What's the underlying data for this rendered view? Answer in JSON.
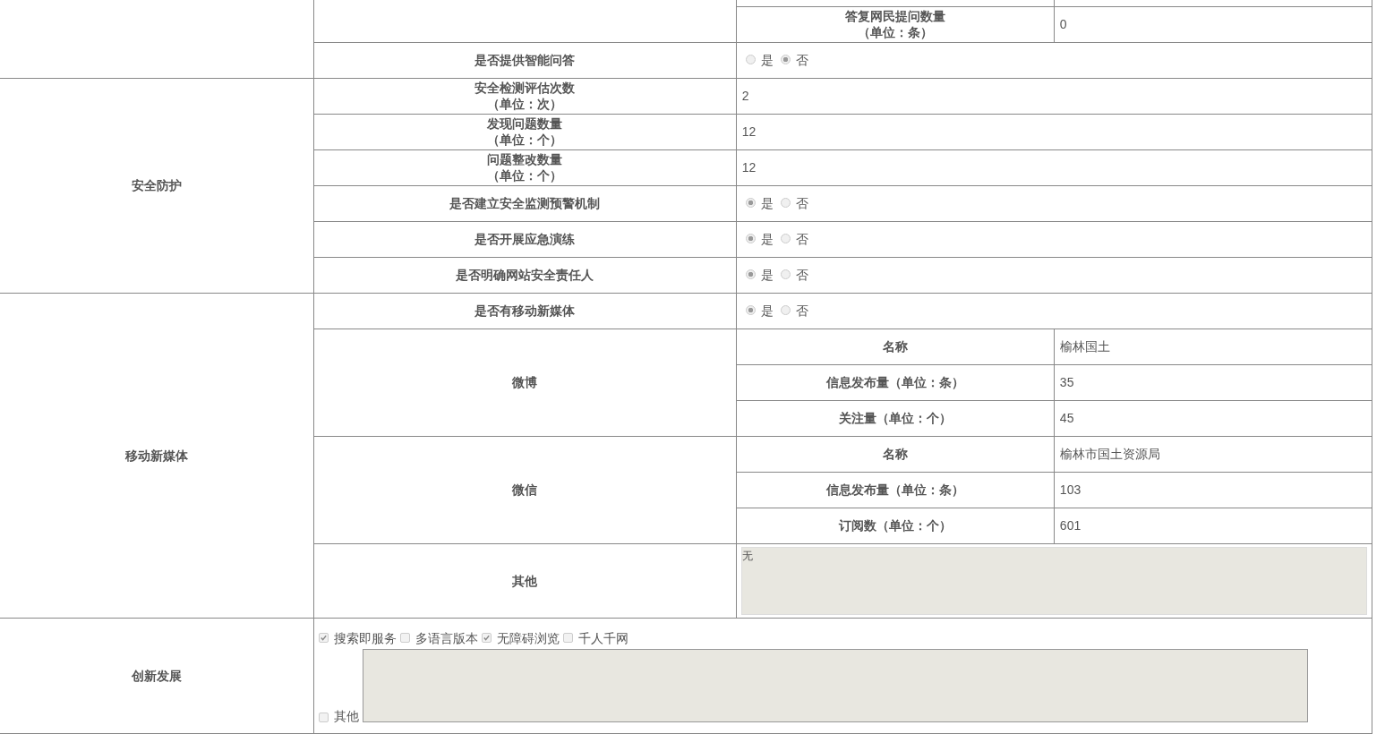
{
  "qa": {
    "reply_count": {
      "label": "答复网民提问数量",
      "unit": "（单位：条）",
      "value": "0"
    },
    "smart_qa": {
      "label": "是否提供智能问答",
      "options": [
        {
          "label": "是",
          "selected": false
        },
        {
          "label": "否",
          "selected": true
        }
      ]
    }
  },
  "security": {
    "title": "安全防护",
    "counts": [
      {
        "label": "安全检测评估次数",
        "unit": "（单位：次）",
        "value": "2"
      },
      {
        "label": "发现问题数量",
        "unit": "（单位：个）",
        "value": "12"
      },
      {
        "label": "问题整改数量",
        "unit": "（单位：个）",
        "value": "12"
      }
    ],
    "questions": [
      {
        "label": "是否建立安全监测预警机制",
        "options": [
          {
            "label": "是",
            "selected": true
          },
          {
            "label": "否",
            "selected": false
          }
        ]
      },
      {
        "label": "是否开展应急演练",
        "options": [
          {
            "label": "是",
            "selected": true
          },
          {
            "label": "否",
            "selected": false
          }
        ]
      },
      {
        "label": "是否明确网站安全责任人",
        "options": [
          {
            "label": "是",
            "selected": true
          },
          {
            "label": "否",
            "selected": false
          }
        ]
      }
    ]
  },
  "media": {
    "title": "移动新媒体",
    "has_media": {
      "label": "是否有移动新媒体",
      "options": [
        {
          "label": "是",
          "selected": true
        },
        {
          "label": "否",
          "selected": false
        }
      ]
    },
    "accounts": [
      {
        "name": "微博",
        "fields": [
          {
            "label": "名称",
            "value": "榆林国土"
          },
          {
            "label": "信息发布量（单位：条）",
            "value": "35"
          },
          {
            "label": "关注量（单位：个）",
            "value": "45"
          }
        ]
      },
      {
        "name": "微信",
        "fields": [
          {
            "label": "名称",
            "value": "榆林市国土资源局"
          },
          {
            "label": "信息发布量（单位：条）",
            "value": "103"
          },
          {
            "label": "订阅数（单位：个）",
            "value": "601"
          }
        ]
      }
    ],
    "other": {
      "label": "其他",
      "value": "无"
    }
  },
  "innovation": {
    "title": "创新发展",
    "options": [
      {
        "label": "搜索即服务",
        "checked": true
      },
      {
        "label": "多语言版本",
        "checked": false
      },
      {
        "label": "无障碍浏览",
        "checked": true
      },
      {
        "label": "千人千网",
        "checked": false
      }
    ],
    "other": {
      "label": "其他",
      "checked": false
    }
  }
}
